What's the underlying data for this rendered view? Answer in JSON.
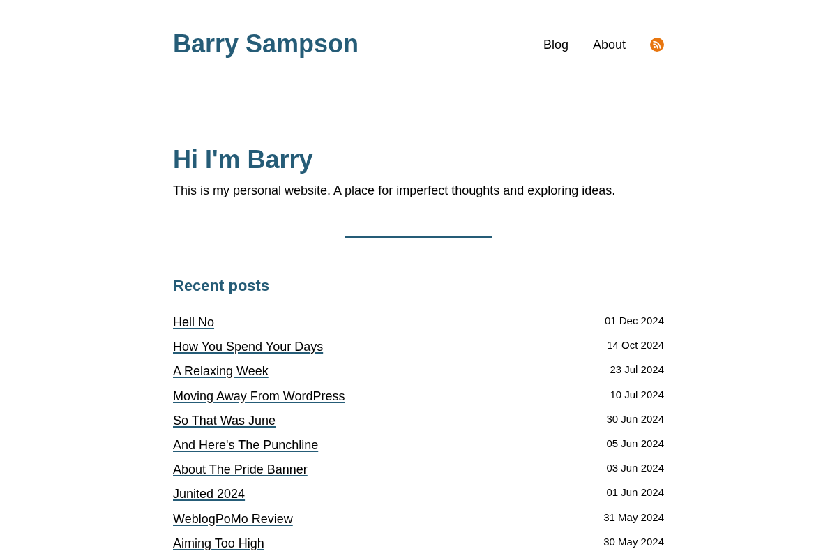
{
  "header": {
    "site_title": "Barry Sampson",
    "nav": [
      {
        "label": "Blog"
      },
      {
        "label": "About"
      }
    ]
  },
  "hero": {
    "heading": "Hi I'm Barry",
    "text": "This is my personal website. A place for imperfect thoughts and exploring ideas."
  },
  "recent_posts": {
    "heading": "Recent posts",
    "posts": [
      {
        "title": "Hell No",
        "date": "01 Dec 2024"
      },
      {
        "title": "How You Spend Your Days",
        "date": "14 Oct 2024"
      },
      {
        "title": "A Relaxing Week",
        "date": "23 Jul 2024"
      },
      {
        "title": "Moving Away From WordPress",
        "date": "10 Jul 2024"
      },
      {
        "title": "So That Was June",
        "date": "30 Jun 2024"
      },
      {
        "title": "And Here's The Punchline",
        "date": "05 Jun 2024"
      },
      {
        "title": "About The Pride Banner",
        "date": "03 Jun 2024"
      },
      {
        "title": "Junited 2024",
        "date": "01 Jun 2024"
      },
      {
        "title": "WeblogPoMo Review",
        "date": "31 May 2024"
      },
      {
        "title": "Aiming Too High",
        "date": "30 May 2024"
      }
    ]
  }
}
